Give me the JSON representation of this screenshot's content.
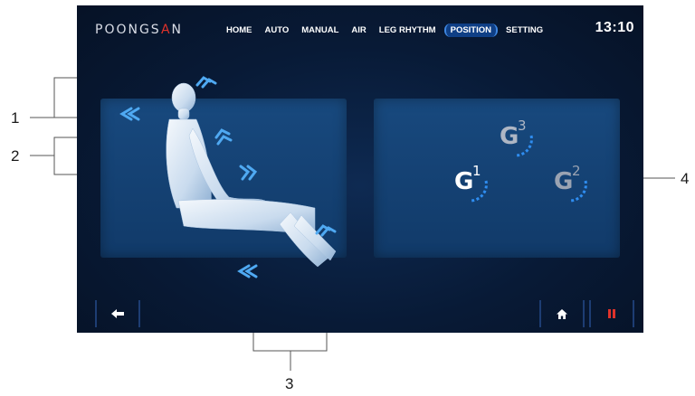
{
  "header": {
    "brand_left": "POONGS",
    "brand_accent": "A",
    "brand_right": "N",
    "nav": [
      {
        "label": "HOME",
        "active": false
      },
      {
        "label": "AUTO",
        "active": false
      },
      {
        "label": "MANUAL",
        "active": false
      },
      {
        "label": "AIR",
        "active": false
      },
      {
        "label": "LEG RHYTHM",
        "active": false
      },
      {
        "label": "POSITION",
        "active": true
      },
      {
        "label": "SETTING",
        "active": false
      }
    ],
    "clock": "13:10"
  },
  "positions": [
    {
      "base": "G",
      "superscript": "1",
      "selected": true
    },
    {
      "base": "G",
      "superscript": "2",
      "selected": false
    },
    {
      "base": "G",
      "superscript": "3",
      "selected": false
    }
  ],
  "footer": {
    "back_icon": "back-arrow-icon",
    "home_icon": "home-icon",
    "pause_icon": "pause-icon"
  },
  "annotations": [
    "1",
    "2",
    "3",
    "4"
  ],
  "colors": {
    "screen_bg": "#081a36",
    "panel": "#163f73",
    "accent_blue": "#2f8df0",
    "selected_g": "#ffffff",
    "unselected_g": "#9aa3b2",
    "pause_red": "#e0322a",
    "brand_red": "#e0322a"
  }
}
